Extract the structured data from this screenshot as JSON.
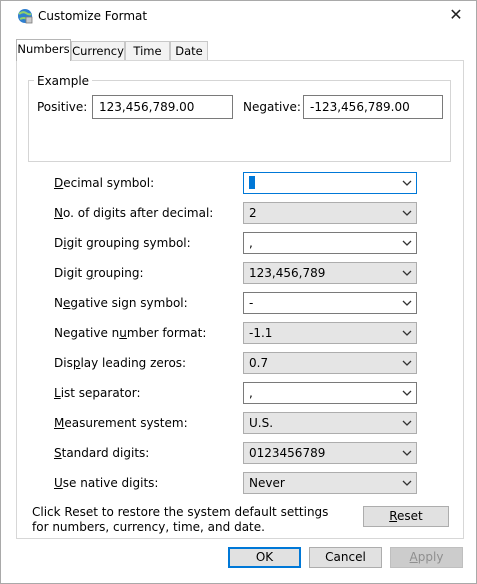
{
  "window": {
    "title": "Customize Format"
  },
  "tabs": [
    {
      "label": "Numbers",
      "active": true
    },
    {
      "label": "Currency",
      "active": false
    },
    {
      "label": "Time",
      "active": false
    },
    {
      "label": "Date",
      "active": false
    }
  ],
  "example": {
    "legend": "Example",
    "positive_label": "Positive:",
    "positive_value": "123,456,789.00",
    "negative_label": "Negative:",
    "negative_value": "-123,456,789.00"
  },
  "settings": [
    {
      "label": "Decimal symbol:",
      "value": ".",
      "kind": "editable"
    },
    {
      "label": "No. of digits after decimal:",
      "value": "2",
      "kind": "dropdown"
    },
    {
      "label": "Digit grouping symbol:",
      "value": ",",
      "kind": "editable"
    },
    {
      "label": "Digit grouping:",
      "value": "123,456,789",
      "kind": "dropdown"
    },
    {
      "label": "Negative sign symbol:",
      "value": "-",
      "kind": "editable"
    },
    {
      "label": "Negative number format:",
      "value": "-1.1",
      "kind": "dropdown"
    },
    {
      "label": "Display leading zeros:",
      "value": "0.7",
      "kind": "dropdown"
    },
    {
      "label": "List separator:",
      "value": ",",
      "kind": "editable"
    },
    {
      "label": "Measurement system:",
      "value": "U.S.",
      "kind": "dropdown"
    },
    {
      "label": "Standard digits:",
      "value": "0123456789",
      "kind": "dropdown"
    },
    {
      "label": "Use native digits:",
      "value": "Never",
      "kind": "dropdown"
    }
  ],
  "reset_info": "Click Reset to restore the system default settings for numbers, currency, time, and date.",
  "buttons": {
    "reset": "Reset",
    "ok": "OK",
    "cancel": "Cancel",
    "apply": "Apply"
  },
  "colors": {
    "accent": "#0078d7"
  },
  "icons": {
    "title": "globe-settings-icon",
    "close": "close-icon",
    "dropdown": "chevron-down-icon"
  }
}
